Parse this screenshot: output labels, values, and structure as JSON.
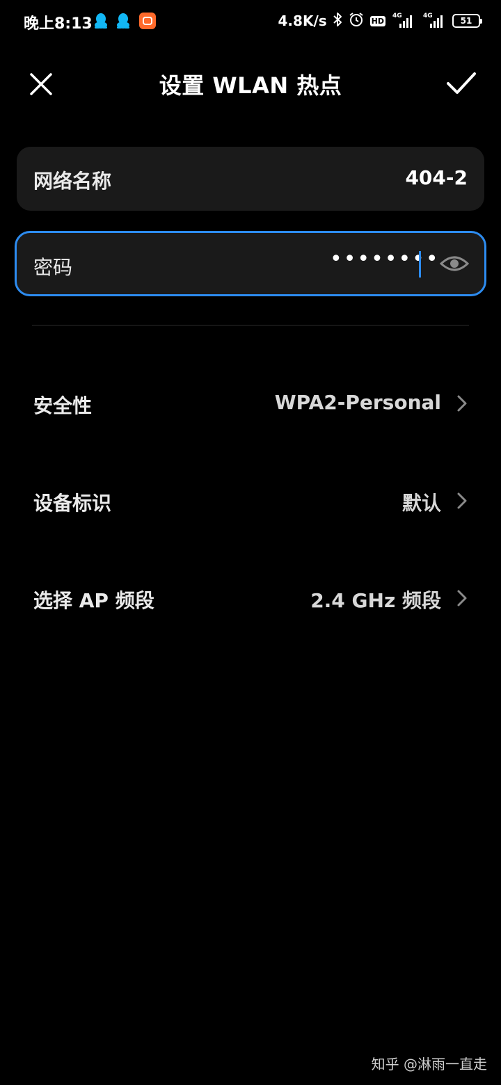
{
  "status_bar": {
    "time": "晚上8:13",
    "net_speed": "4.8K/s",
    "hd": "HD",
    "signal1_tag": "4G",
    "signal2_tag": "4G",
    "battery": "51",
    "icons": [
      "qq-icon",
      "qq-icon",
      "app-notification-icon",
      "bluetooth-icon",
      "alarm-icon",
      "hd-icon",
      "signal-icon",
      "signal-icon",
      "battery-icon"
    ]
  },
  "header": {
    "title": "设置 WLAN 热点",
    "close_icon": "close-icon",
    "confirm_icon": "check-icon"
  },
  "network_name": {
    "label": "网络名称",
    "value": "404-2"
  },
  "password": {
    "label": "密码",
    "masked_value": "••••••••",
    "toggle_icon": "eye-icon"
  },
  "settings": [
    {
      "label": "安全性",
      "value": "WPA2-Personal"
    },
    {
      "label": "设备标识",
      "value": "默认"
    },
    {
      "label": "选择 AP 频段",
      "value": "2.4 GHz 频段"
    }
  ],
  "watermark": "知乎 @淋雨一直走",
  "colors": {
    "background": "#000000",
    "card": "#1a1a1a",
    "accent": "#2d8cf0",
    "qq_blue": "#12b7f5",
    "app_orange": "#ff6a2b"
  }
}
